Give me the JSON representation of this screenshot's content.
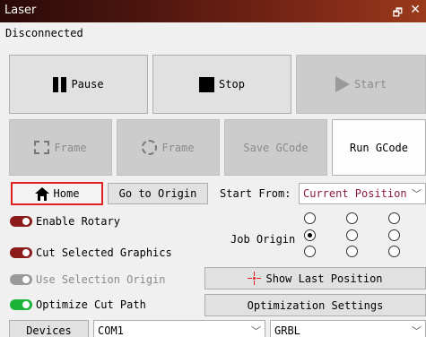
{
  "window": {
    "title": "Laser",
    "restore_glyph": "🗗",
    "close_glyph": "✕"
  },
  "status": "Disconnected",
  "controls": {
    "pause": "Pause",
    "stop": "Stop",
    "start": "Start",
    "frame_rect": "Frame",
    "frame_circle": "Frame",
    "save_gcode": "Save GCode",
    "run_gcode": "Run GCode",
    "home": "Home",
    "go_to_origin": "Go to Origin"
  },
  "start_from": {
    "label": "Start From:",
    "value": "Current Position"
  },
  "job_origin": {
    "label": "Job Origin",
    "selected": "middle-left"
  },
  "options": [
    {
      "label": "Enable Rotary",
      "state": "off"
    },
    {
      "label": "Cut Selected Graphics",
      "state": "off"
    },
    {
      "label": "Use Selection Origin",
      "state": "disabled"
    },
    {
      "label": "Optimize Cut Path",
      "state": "on"
    }
  ],
  "show_last_position": "Show Last Position",
  "optimization_settings": "Optimization Settings",
  "devices": {
    "label": "Devices",
    "port": "COM1",
    "controller": "GRBL"
  },
  "colors": {
    "accent_red": "#e02020",
    "toggle_on": "#1db33a",
    "toggle_off": "#8b1a1a"
  }
}
